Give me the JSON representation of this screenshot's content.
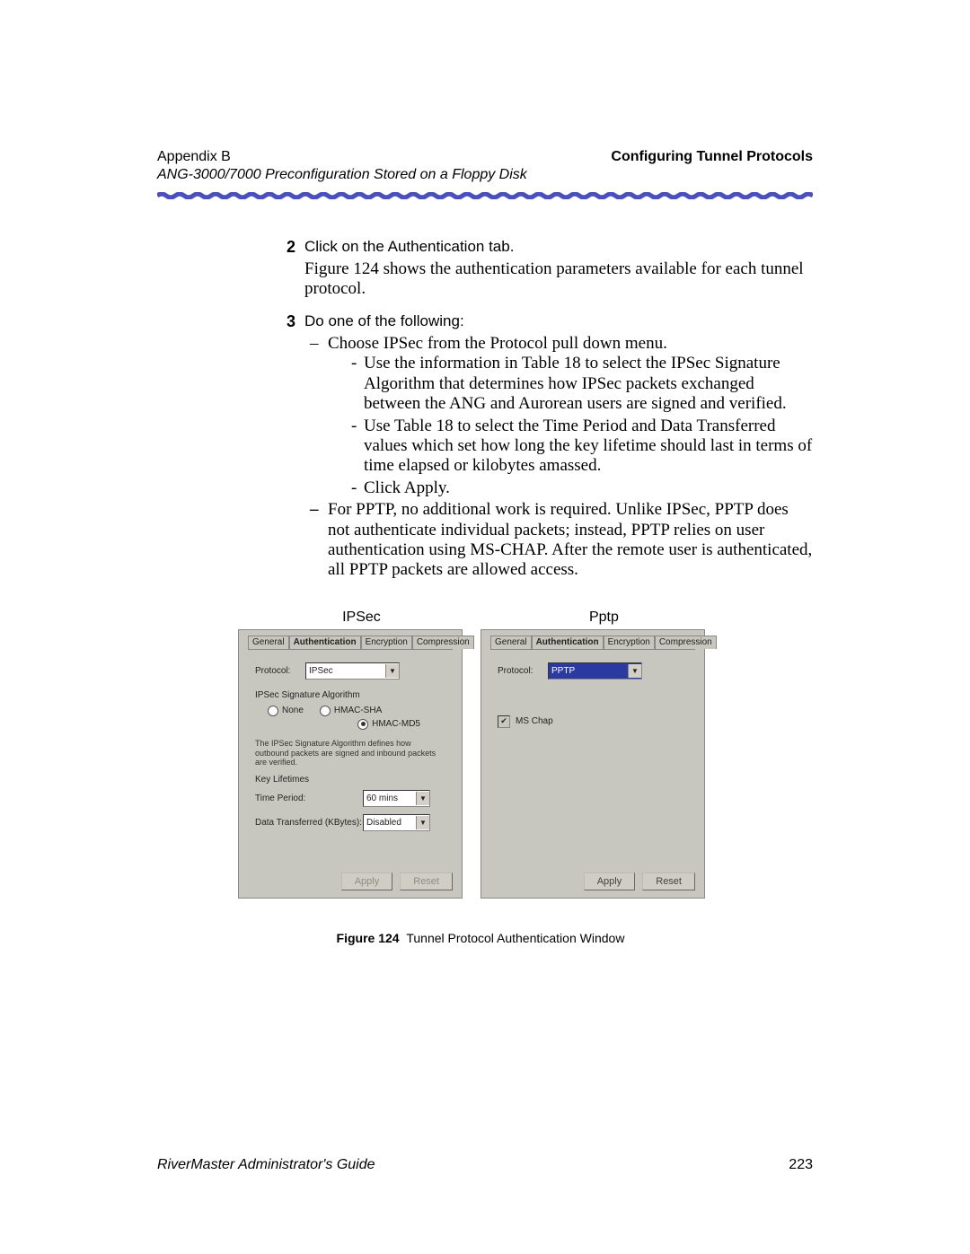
{
  "header": {
    "appendix": "Appendix B",
    "section": "Configuring Tunnel Protocols",
    "subtitle": "ANG-3000/7000 Preconfiguration Stored on a Floppy Disk"
  },
  "steps": {
    "s2": {
      "num": "2",
      "line1": "Click on the Authentication tab.",
      "line2": "Figure 124 shows the authentication parameters available for each tunnel protocol."
    },
    "s3": {
      "num": "3",
      "intro": "Do one of the following:",
      "opt1": "Choose IPSec from the Protocol pull down menu.",
      "opt1a": "Use the information in Table 18 to select the IPSec Signature Algorithm that determines how IPSec packets exchanged between the ANG and Aurorean users are signed and verified.",
      "opt1b": "Use Table 18 to select the Time Period and Data Transferred values which set how long the key lifetime should last in terms of time elapsed or kilobytes amassed.",
      "opt1c": "Click Apply.",
      "opt2": "For PPTP, no additional work is required. Unlike IPSec, PPTP does not authenticate individual packets; instead, PPTP relies on user authentication using MS-CHAP. After the remote user is authenticated, all PPTP packets are allowed access."
    }
  },
  "figure": {
    "header_ipsec": "IPSec",
    "header_pptp": "Pptp",
    "tabs": {
      "general": "General",
      "auth": "Authentication",
      "enc": "Encryption",
      "comp": "Compression"
    },
    "ipsec": {
      "protocol_label": "Protocol:",
      "protocol_value": "IPSec",
      "group_title": "IPSec Signature Algorithm",
      "r_none": "None",
      "r_sha": "HMAC-SHA",
      "r_md5": "HMAC-MD5",
      "desc": "The IPSec Signature Algorithm defines how outbound packets are signed and inbound packets are verified.",
      "keylife_title": "Key Lifetimes",
      "time_label": "Time Period:",
      "time_value": "60 mins",
      "data_label": "Data Transferred (KBytes):",
      "data_value": "Disabled",
      "apply": "Apply",
      "reset": "Reset"
    },
    "pptp": {
      "protocol_label": "Protocol:",
      "protocol_value": "PPTP",
      "mschap": "MS Chap",
      "apply": "Apply",
      "reset": "Reset"
    },
    "caption_prefix": "Figure 124",
    "caption_text": "Tunnel Protocol Authentication Window"
  },
  "footer": {
    "guide": "RiverMaster Administrator's Guide",
    "page": "223"
  }
}
